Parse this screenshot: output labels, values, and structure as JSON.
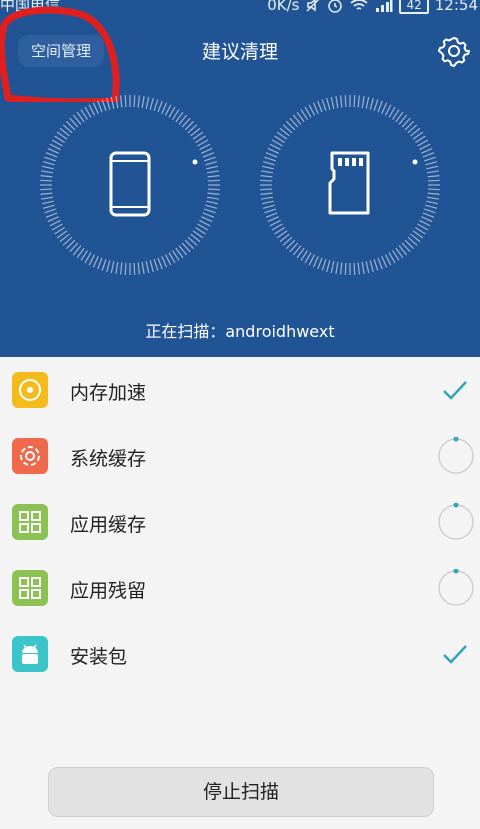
{
  "status_bar": {
    "carrier": "中国电信",
    "network_speed": "0K/s",
    "battery": "42",
    "time": "12:54"
  },
  "header": {
    "space_manage_label": "空间管理",
    "title": "建议清理"
  },
  "scan": {
    "text": "正在扫描：androidhwext"
  },
  "items": [
    {
      "label": "内存加速",
      "icon": "memory-icon",
      "color": "#f3bb1c",
      "status": "done"
    },
    {
      "label": "系统缓存",
      "icon": "flower-gear-icon",
      "color": "#ef6a4d",
      "status": "scanning"
    },
    {
      "label": "应用缓存",
      "icon": "grid-icon",
      "color": "#8cc153",
      "status": "scanning"
    },
    {
      "label": "应用残留",
      "icon": "grid-icon",
      "color": "#8cc153",
      "status": "scanning"
    },
    {
      "label": "安装包",
      "icon": "android-icon",
      "color": "#3bc4c9",
      "status": "done"
    }
  ],
  "stop_button": "停止扫描",
  "colors": {
    "header_bg": "#215495",
    "accent_teal": "#2fa6b8"
  }
}
